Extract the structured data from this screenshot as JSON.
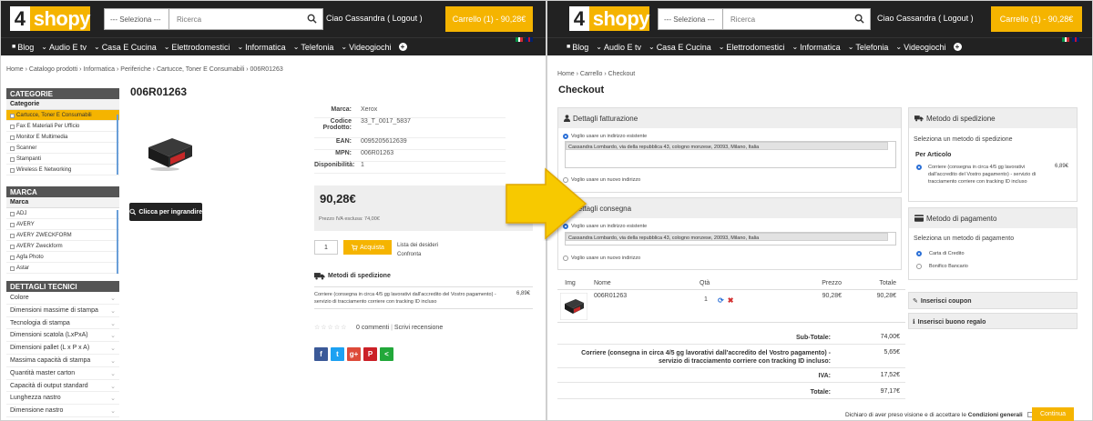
{
  "header": {
    "logo_four": "4",
    "logo_name": "shopy",
    "select_label": "--- Seleziona ---",
    "search_placeholder": "Ricerca",
    "greeting": "Ciao",
    "user_name": "Cassandra",
    "logout": "( Logout )",
    "cart_label": "Carrello (1) - 90,28€"
  },
  "nav": {
    "items": [
      {
        "label": "Blog",
        "prefix": "■"
      },
      {
        "label": "Audio E tv",
        "prefix": "⌄"
      },
      {
        "label": "Casa E Cucina",
        "prefix": "⌄"
      },
      {
        "label": "Elettrodomestici",
        "prefix": "⌄"
      },
      {
        "label": "Informatica",
        "prefix": "⌄"
      },
      {
        "label": "Telefonia",
        "prefix": "⌄"
      },
      {
        "label": "Videogiochi",
        "prefix": "⌄"
      }
    ],
    "flag_colors": {
      "it": [
        "#009246",
        "#ffffff",
        "#ce2b37"
      ],
      "en": [
        "#012169",
        "#ffffff",
        "#c8102e"
      ]
    }
  },
  "left": {
    "breadcrumb": "Home › Catalogo prodotti › Informatica › Periferiche › Cartucce, Toner E Consumabili › 006R01263",
    "sidebar": {
      "categories_title": "CATEGORIE",
      "categories_sub": "Categorie",
      "categories": [
        {
          "label": "Cartucce, Toner E Consumabili",
          "active": true
        },
        {
          "label": "Fax E Materiali Per Ufficio",
          "active": false
        },
        {
          "label": "Monitor E Multimedia",
          "active": false
        },
        {
          "label": "Scanner",
          "active": false
        },
        {
          "label": "Stampanti",
          "active": false
        },
        {
          "label": "Wireless E Networking",
          "active": false
        }
      ],
      "brand_title": "MARCA",
      "brand_sub": "Marca",
      "brands": [
        "ADJ",
        "AVERY",
        "AVERY ZWECKFORM",
        "AVERY Zweckform",
        "Agfa Photo",
        "Astar"
      ],
      "tech_title": "DETTAGLI TECNICI",
      "tech": [
        "Colore",
        "Dimensioni massime di stampa",
        "Tecnologia di stampa",
        "Dimensioni scatola (LxPxA)",
        "Dimensioni pallet (L x P x A)",
        "Massima capacità di stampa",
        "Quantità master carton",
        "Capacità di output standard",
        "Lunghezza nastro",
        "Dimensione nastro"
      ]
    },
    "product": {
      "title": "006R01263",
      "zoom_label": "Clicca per ingrandire",
      "specs": [
        {
          "k": "Marca:",
          "v": "Xerox"
        },
        {
          "k": "Codice Prodotto:",
          "v": "33_T_0017_5837"
        },
        {
          "k": "EAN:",
          "v": "0095205612639"
        },
        {
          "k": "MPN:",
          "v": "006R01263"
        },
        {
          "k": "Disponibilità:",
          "v": "1"
        }
      ],
      "price": "90,28€",
      "price_note": "Prezzo IVA esclusa: 74,00€",
      "qty": "1",
      "add_label": "Acquista",
      "wishlist": "Lista dei desideri",
      "compare": "Confronta",
      "shipping_title": "Metodi di spedizione",
      "shipping_text": "Corriere (consegna in circa 4/5 gg lavorativi dall'accredito del Vostro pagamento) - servizio di tracciamento corriere con tracking ID incluso",
      "shipping_price": "6,89€",
      "rating_stars": 0,
      "reviews": "0 commenti",
      "write_review": "Scrivi recensione",
      "social": [
        {
          "icon": "f",
          "color": "#3b5998",
          "name": "facebook"
        },
        {
          "icon": "t",
          "color": "#1da1f2",
          "name": "twitter"
        },
        {
          "icon": "g+",
          "color": "#dd4b39",
          "name": "google-plus"
        },
        {
          "icon": "P",
          "color": "#cb2027",
          "name": "pinterest"
        },
        {
          "icon": "<",
          "color": "#22a83a",
          "name": "share"
        }
      ]
    }
  },
  "right": {
    "breadcrumb": "Home › Carrello › Checkout",
    "title": "Checkout",
    "billing": {
      "title": "Dettagli fatturazione",
      "existing": "Voglio usare un indirizzo esistente",
      "address": "Cassandra Lombardo, via della repubblica 43, cologno monzese, 20093, Milano, Italia",
      "new": "Voglio usare un nuovo indirizzo"
    },
    "delivery": {
      "title": "Dettagli consegna",
      "existing": "Voglio usare un indirizzo esistente",
      "address": "Cassandra Lombardo, via della repubblica 43, cologno monzese, 20093, Milano, Italia",
      "new": "Voglio usare un nuovo indirizzo"
    },
    "shipping": {
      "title": "Metodo di spedizione",
      "prompt": "Seleziona un metodo di spedizione",
      "group": "Per Articolo",
      "option": "Corriere (consegna in circa 4/5 gg lavorativi dall'accredito del Vostro pagamento) - servizio di tracciamento corriere con tracking ID incluso",
      "price": "6,89€"
    },
    "payment": {
      "title": "Metodo di pagamento",
      "prompt": "Seleziona un metodo di pagamento",
      "options": [
        "Carta di Credito",
        "Bonifico Bancario"
      ]
    },
    "coupon": "Inserisci coupon",
    "voucher": "Inserisci buono regalo",
    "table": {
      "headers": [
        "Img",
        "Nome",
        "Qtà",
        "Prezzo",
        "Totale"
      ],
      "row": {
        "name": "006R01263",
        "qty": "1",
        "price": "90,28€",
        "total": "90,28€"
      }
    },
    "totals": [
      {
        "label": "Sub-Totale:",
        "value": "74,00€"
      },
      {
        "label": "Corriere (consegna in circa 4/5 gg lavorativi dall'accredito del Vostro pagamento) - servizio di tracciamento corriere con tracking ID incluso:",
        "value": "5,65€"
      },
      {
        "label": "IVA:",
        "value": "17,52€"
      },
      {
        "label": "Totale:",
        "value": "97,17€"
      }
    ],
    "conditions_prefix": "Dichiaro di aver preso visione e di accettare le",
    "conditions_link": "Condizioni generali",
    "continue": "Continua"
  },
  "colors": {
    "accent": "#f5b400",
    "dark": "#222222",
    "arrow": "#f7c900"
  }
}
